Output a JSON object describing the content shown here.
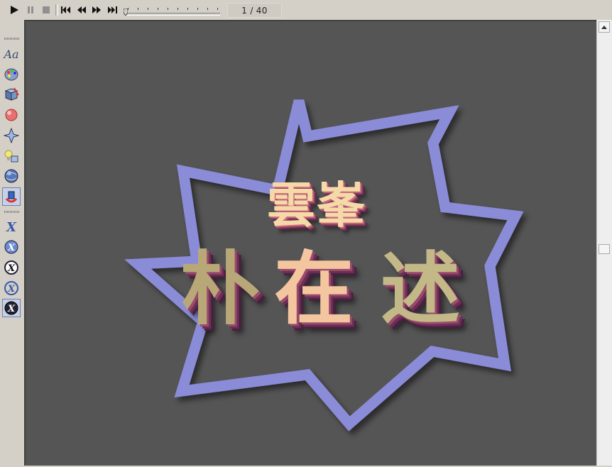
{
  "toolbar": {
    "play": "play-icon",
    "pause": "pause-icon",
    "stop": "stop-icon",
    "first": "first-frame-icon",
    "prev": "previous-frame-icon",
    "next": "next-frame-icon",
    "last": "last-frame-icon",
    "frame_counter": "1 / 40",
    "slider_position": 0.0
  },
  "left_toolbar": {
    "tools": [
      {
        "name": "text-style-tool",
        "label": "Aa"
      },
      {
        "name": "palette-tool"
      },
      {
        "name": "texture-cube-tool"
      },
      {
        "name": "sphere-tool"
      },
      {
        "name": "star-shape-tool"
      },
      {
        "name": "lighting-tool"
      },
      {
        "name": "globe-tool"
      },
      {
        "name": "object-3d-tool",
        "active": true
      },
      {
        "name": "x-tool-1"
      },
      {
        "name": "x-tool-2"
      },
      {
        "name": "x-tool-3"
      },
      {
        "name": "x-tool-4"
      },
      {
        "name": "x-tool-5",
        "active": true
      }
    ],
    "text_label": "Aa"
  },
  "canvas": {
    "background": "#555555",
    "burst_stroke": "#8a8cd8",
    "title_small": [
      "雲",
      "峯"
    ],
    "title_big": [
      "朴",
      "在",
      "述"
    ]
  }
}
